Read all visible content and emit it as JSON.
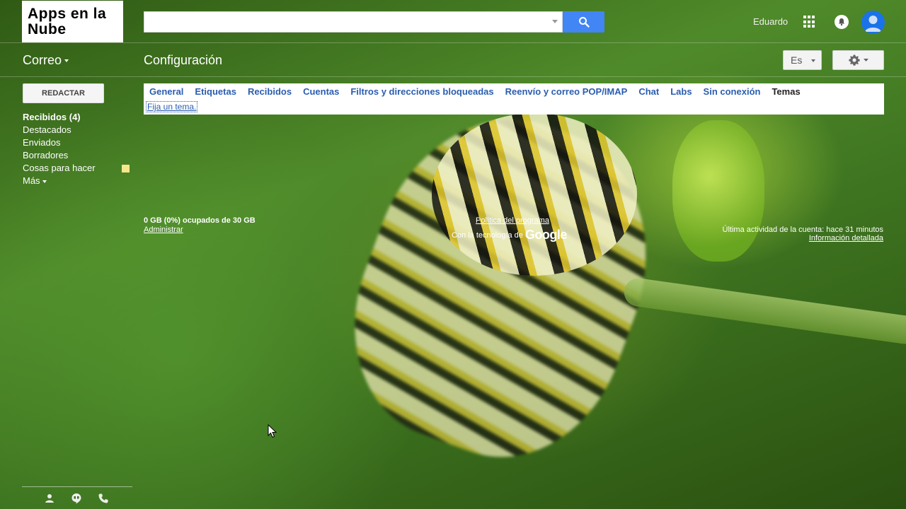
{
  "header": {
    "logo_text": "Apps en la Nube",
    "search_placeholder": "",
    "user_name": "Eduardo",
    "icons": {
      "search": "search-icon",
      "apps": "apps-grid-icon",
      "notifications": "bell-icon",
      "account": "avatar-icon"
    },
    "accent_color": "#4285f4"
  },
  "toolbar": {
    "app_switch_label": "Correo",
    "page_title": "Configuración",
    "language_label": "Es",
    "settings_icon": "gear-icon"
  },
  "sidebar": {
    "compose_label": "REDACTAR",
    "items": [
      {
        "label": "Recibidos (4)",
        "bold": true
      },
      {
        "label": "Destacados"
      },
      {
        "label": "Enviados"
      },
      {
        "label": "Borradores"
      },
      {
        "label": "Cosas para hacer",
        "swatch_color": "#f7e78c"
      },
      {
        "label": "Más"
      }
    ],
    "bottom_icons": [
      "person-icon",
      "hangouts-icon",
      "phone-icon"
    ]
  },
  "settings": {
    "tabs": [
      {
        "label": "General"
      },
      {
        "label": "Etiquetas"
      },
      {
        "label": "Recibidos"
      },
      {
        "label": "Cuentas"
      },
      {
        "label": "Filtros y direcciones bloqueadas"
      },
      {
        "label": "Reenvío y correo POP/IMAP"
      },
      {
        "label": "Chat"
      },
      {
        "label": "Labs"
      },
      {
        "label": "Sin conexión"
      },
      {
        "label": "Temas",
        "active": true
      }
    ],
    "theme_link": "Fija un tema."
  },
  "footer": {
    "storage": "0 GB (0%) ocupados de 30 GB",
    "manage_link": "Administrar",
    "policy_link": "Política del programa",
    "powered_by": "Con la tecnología de",
    "powered_brand": "Google",
    "last_activity": "Última actividad de la cuenta: hace 31 minutos",
    "details_link": "Información detallada"
  }
}
